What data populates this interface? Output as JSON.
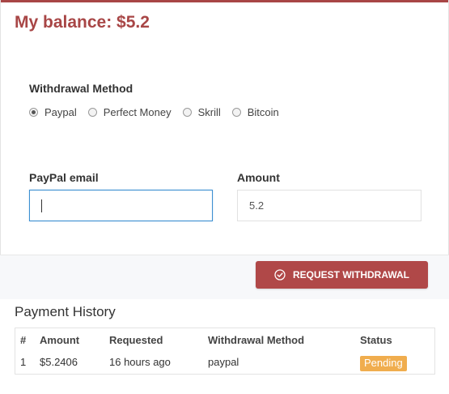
{
  "header": {
    "title": "My balance: $5.2"
  },
  "withdrawal_method": {
    "label": "Withdrawal Method",
    "options": [
      "Paypal",
      "Perfect Money",
      "Skrill",
      "Bitcoin"
    ],
    "selected": "Paypal"
  },
  "form": {
    "email_label": "PayPal email",
    "email_value": "",
    "amount_label": "Amount",
    "amount_value": "5.2"
  },
  "actions": {
    "request_label": "REQUEST WITHDRAWAL"
  },
  "history": {
    "title": "Payment History",
    "columns": [
      "#",
      "Amount",
      "Requested",
      "Withdrawal Method",
      "Status"
    ],
    "rows": [
      {
        "num": "1",
        "amount": "$5.2406",
        "requested": "16 hours ago",
        "method": "paypal",
        "status": "Pending"
      }
    ]
  },
  "colors": {
    "brand": "#a84646",
    "button": "#b04848",
    "pending": "#f0ad4e",
    "focus": "#3b8fd1"
  }
}
